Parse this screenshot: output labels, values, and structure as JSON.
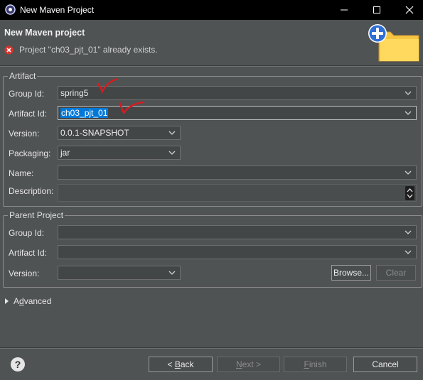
{
  "window": {
    "title": "New Maven Project"
  },
  "header": {
    "title": "New Maven project",
    "error_message": "Project \"ch03_pjt_01\" already exists."
  },
  "artifact": {
    "legend": "Artifact",
    "group_id": {
      "label": "Group Id:",
      "value": "spring5"
    },
    "artifact_id": {
      "label": "Artifact Id:",
      "value": "ch03_pjt_01"
    },
    "version": {
      "label": "Version:",
      "value": "0.0.1-SNAPSHOT"
    },
    "packaging": {
      "label": "Packaging:",
      "value": "jar"
    },
    "name": {
      "label": "Name:",
      "value": ""
    },
    "description": {
      "label": "Description:",
      "value": ""
    }
  },
  "parent": {
    "legend": "Parent Project",
    "group_id": {
      "label": "Group Id:",
      "value": ""
    },
    "artifact_id": {
      "label": "Artifact Id:",
      "value": ""
    },
    "version": {
      "label": "Version:",
      "value": ""
    },
    "browse_label": "Browse...",
    "clear_label": "Clear"
  },
  "advanced": {
    "label": "Advanced"
  },
  "footer": {
    "back_label": "< Back",
    "next_label": "Next >",
    "finish_label": "Finish",
    "cancel_label": "Cancel"
  },
  "colors": {
    "background": "#505354",
    "titlebar": "#000000",
    "selection": "#0078d7",
    "annotation": "#e0181d",
    "error": "#d9342b"
  },
  "icons": {
    "app": "gear-icon",
    "error": "error-icon",
    "wizard": "new-folder-icon",
    "help": "help-icon"
  }
}
